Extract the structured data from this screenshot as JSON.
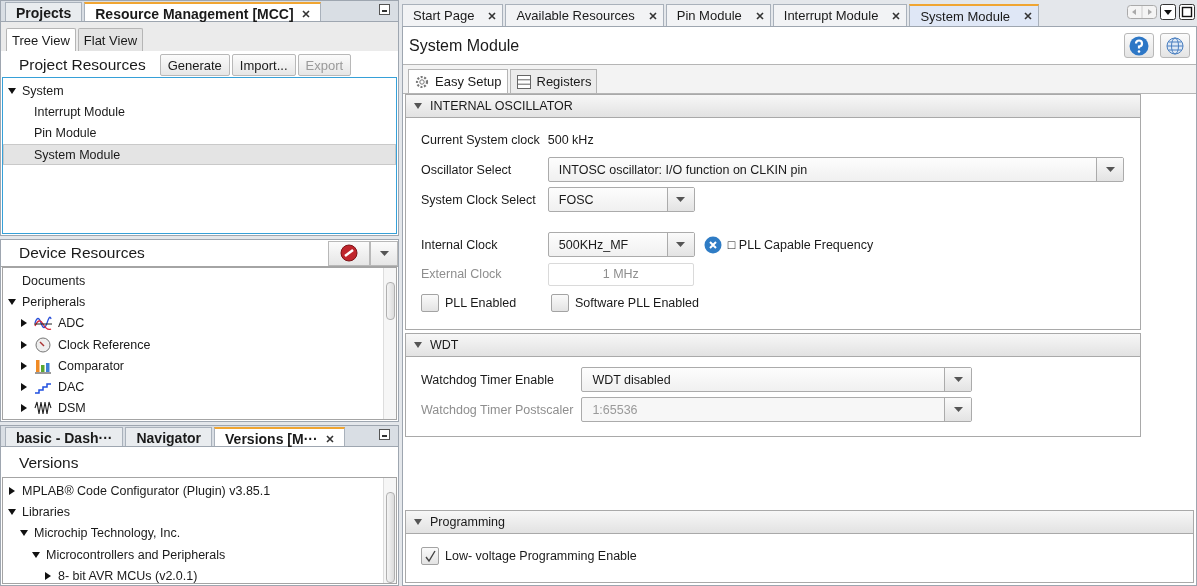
{
  "projects_panel": {
    "tabs": [
      {
        "label": "Projects",
        "selected": false,
        "closable": false
      },
      {
        "label": "Resource Management [MCC]",
        "selected": true,
        "closable": true
      }
    ],
    "view_tabs": [
      {
        "label": "Tree View",
        "selected": true
      },
      {
        "label": "Flat View",
        "selected": false
      }
    ],
    "title": "Project Resources",
    "buttons": [
      {
        "label": "Generate",
        "disabled": false
      },
      {
        "label": "Import...",
        "disabled": false
      },
      {
        "label": "Export",
        "disabled": true
      }
    ],
    "tree": [
      {
        "label": "System",
        "expanded": true,
        "selected": false,
        "children": [
          {
            "label": "Interrupt Module",
            "selected": false
          },
          {
            "label": "Pin Module",
            "selected": false
          },
          {
            "label": "System Module",
            "selected": true
          }
        ]
      }
    ]
  },
  "device_resources": {
    "title": "Device Resources",
    "tree": [
      {
        "label": "Documents"
      },
      {
        "label": "Peripherals",
        "expanded": true,
        "children": [
          {
            "label": "ADC",
            "expanded": false
          },
          {
            "label": "Clock Reference",
            "expanded": false
          },
          {
            "label": "Comparator",
            "expanded": false
          },
          {
            "label": "DAC",
            "expanded": false
          },
          {
            "label": "DSM",
            "expanded": false
          }
        ]
      }
    ]
  },
  "versions_panel": {
    "tabs": [
      {
        "label": "basic - Dash···",
        "selected": false,
        "closable": false
      },
      {
        "label": "Navigator",
        "selected": false,
        "closable": false
      },
      {
        "label": "Versions [M···",
        "selected": true,
        "closable": true
      }
    ],
    "title": "Versions",
    "tree": [
      {
        "label": "MPLAB® Code Configurator (Plugin) v3.85.1",
        "expanded": false
      },
      {
        "label": "Libraries",
        "expanded": true,
        "children": [
          {
            "label": "Microchip Technology, Inc.",
            "expanded": true,
            "children": [
              {
                "label": "Microcontrollers and Peripherals",
                "expanded": true,
                "children": [
                  {
                    "label": "8- bit AVR MCUs (v2.0.1)",
                    "expanded": false
                  }
                ]
              }
            ]
          }
        ]
      }
    ]
  },
  "editor": {
    "tabs": [
      {
        "label": "Start Page",
        "selected": false,
        "closable": true
      },
      {
        "label": "Available Resources",
        "selected": false,
        "closable": true
      },
      {
        "label": "Pin Module",
        "selected": false,
        "closable": true
      },
      {
        "label": "Interrupt Module",
        "selected": false,
        "closable": true
      },
      {
        "label": "System Module",
        "selected": true,
        "closable": true
      }
    ],
    "title": "System Module",
    "setup_tabs": [
      {
        "label": "Easy Setup",
        "selected": true
      },
      {
        "label": "Registers",
        "selected": false
      }
    ],
    "sections": [
      {
        "title": "INTERNAL OSCILLATOR",
        "expanded": true,
        "groups": [
          [
            {
              "kind": "readout",
              "label": "Current System clock",
              "value": "500 kHz"
            },
            {
              "kind": "wide-select",
              "label": "Oscillator Select",
              "value": "INTOSC oscillator: I/O function on CLKIN pin"
            },
            {
              "kind": "select",
              "label": "System Clock Select",
              "value": "FOSC"
            }
          ],
          [
            {
              "kind": "select-note",
              "label": "Internal Clock",
              "value": "500KHz_MF",
              "note": "□ PLL Capable Frequency"
            },
            {
              "kind": "field",
              "label": "External Clock",
              "value": "1 MHz",
              "disabled": true
            },
            {
              "kind": "checks",
              "items": [
                {
                  "label": "PLL Enabled",
                  "checked": false
                },
                {
                  "label": "Software PLL Enabled",
                  "checked": false
                }
              ]
            }
          ]
        ]
      },
      {
        "title": "WDT",
        "expanded": true,
        "groups": [
          [
            {
              "kind": "long-select",
              "label": "Watchdog Timer Enable",
              "value": "WDT disabled",
              "disabled": false
            },
            {
              "kind": "long-select",
              "label": "Watchdog Timer Postscaler",
              "value": "1:65536",
              "disabled": true
            }
          ]
        ]
      },
      {
        "title": "Programming",
        "expanded": true,
        "groups": [
          [
            {
              "kind": "checks",
              "items": [
                {
                  "label": "Low- voltage Programming Enable",
                  "checked": true
                }
              ]
            }
          ]
        ]
      }
    ]
  }
}
